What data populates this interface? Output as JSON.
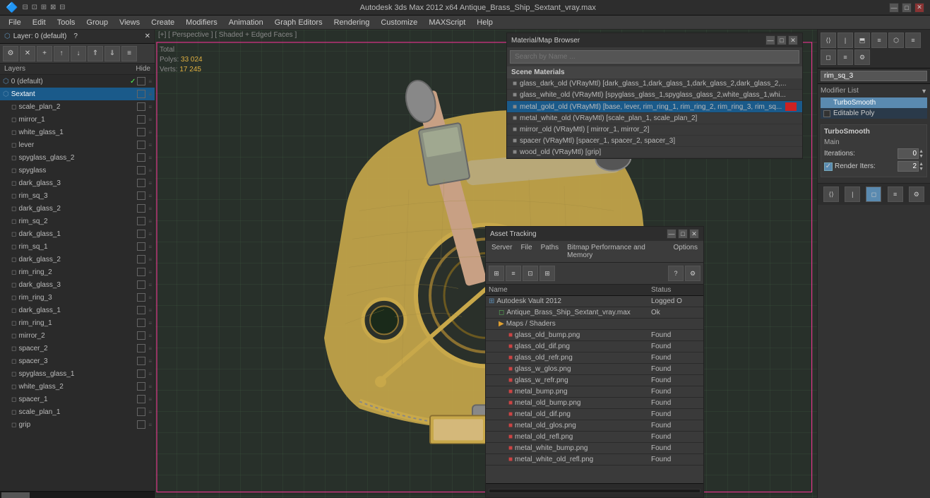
{
  "titleBar": {
    "left": "🔷",
    "center": "Autodesk 3ds Max 2012 x64    Antique_Brass_Ship_Sextant_vray.max",
    "buttons": [
      "—",
      "□",
      "✕"
    ]
  },
  "menuBar": {
    "items": [
      "File",
      "Edit",
      "Tools",
      "Group",
      "Views",
      "Create",
      "Modifiers",
      "Animation",
      "Graph Editors",
      "Rendering",
      "Customize",
      "MAXScript",
      "Help"
    ]
  },
  "viewport": {
    "label": "[+] [ Perspective ] [ Shaded + Edged Faces ]",
    "stats": {
      "label_total": "Total",
      "polys_label": "Polys:",
      "polys_value": "33 024",
      "verts_label": "Verts:",
      "verts_value": "17 245"
    }
  },
  "layerPanel": {
    "title": "Layer: 0 (default)",
    "help_icon": "?",
    "close_icon": "✕",
    "toolbar_buttons": [
      "⚙",
      "✕",
      "+",
      "↑",
      "↓",
      "⇑",
      "⇓",
      "≡"
    ],
    "header_layers": "Layers",
    "header_hide": "Hide",
    "layers": [
      {
        "name": "0 (default)",
        "indent": 0,
        "checked": true,
        "selected": false,
        "icon": "layer"
      },
      {
        "name": "Sextant",
        "indent": 0,
        "checked": false,
        "selected": true,
        "icon": "layer"
      },
      {
        "name": "scale_plan_2",
        "indent": 1,
        "checked": false,
        "selected": false,
        "icon": "object"
      },
      {
        "name": "mirror_1",
        "indent": 1,
        "checked": false,
        "selected": false,
        "icon": "object"
      },
      {
        "name": "white_glass_1",
        "indent": 1,
        "checked": false,
        "selected": false,
        "icon": "object"
      },
      {
        "name": "lever",
        "indent": 1,
        "checked": false,
        "selected": false,
        "icon": "object"
      },
      {
        "name": "spyglass_glass_2",
        "indent": 1,
        "checked": false,
        "selected": false,
        "icon": "object"
      },
      {
        "name": "spyglass",
        "indent": 1,
        "checked": false,
        "selected": false,
        "icon": "object"
      },
      {
        "name": "dark_glass_3",
        "indent": 1,
        "checked": false,
        "selected": false,
        "icon": "object"
      },
      {
        "name": "rim_sq_3",
        "indent": 1,
        "checked": false,
        "selected": false,
        "icon": "object"
      },
      {
        "name": "dark_glass_2",
        "indent": 1,
        "checked": false,
        "selected": false,
        "icon": "object"
      },
      {
        "name": "rim_sq_2",
        "indent": 1,
        "checked": false,
        "selected": false,
        "icon": "object"
      },
      {
        "name": "dark_glass_1",
        "indent": 1,
        "checked": false,
        "selected": false,
        "icon": "object"
      },
      {
        "name": "rim_sq_1",
        "indent": 1,
        "checked": false,
        "selected": false,
        "icon": "object"
      },
      {
        "name": "dark_glass_2",
        "indent": 1,
        "checked": false,
        "selected": false,
        "icon": "object"
      },
      {
        "name": "rim_ring_2",
        "indent": 1,
        "checked": false,
        "selected": false,
        "icon": "object"
      },
      {
        "name": "dark_glass_3",
        "indent": 1,
        "checked": false,
        "selected": false,
        "icon": "object"
      },
      {
        "name": "rim_ring_3",
        "indent": 1,
        "checked": false,
        "selected": false,
        "icon": "object"
      },
      {
        "name": "dark_glass_1",
        "indent": 1,
        "checked": false,
        "selected": false,
        "icon": "object"
      },
      {
        "name": "rim_ring_1",
        "indent": 1,
        "checked": false,
        "selected": false,
        "icon": "object"
      },
      {
        "name": "mirror_2",
        "indent": 1,
        "checked": false,
        "selected": false,
        "icon": "object"
      },
      {
        "name": "spacer_2",
        "indent": 1,
        "checked": false,
        "selected": false,
        "icon": "object"
      },
      {
        "name": "spacer_3",
        "indent": 1,
        "checked": false,
        "selected": false,
        "icon": "object"
      },
      {
        "name": "spyglass_glass_1",
        "indent": 1,
        "checked": false,
        "selected": false,
        "icon": "object"
      },
      {
        "name": "white_glass_2",
        "indent": 1,
        "checked": false,
        "selected": false,
        "icon": "object"
      },
      {
        "name": "spacer_1",
        "indent": 1,
        "checked": false,
        "selected": false,
        "icon": "object"
      },
      {
        "name": "scale_plan_1",
        "indent": 1,
        "checked": false,
        "selected": false,
        "icon": "object"
      },
      {
        "name": "grip",
        "indent": 1,
        "checked": false,
        "selected": false,
        "icon": "object"
      }
    ]
  },
  "modifierPanel": {
    "modifier_list_label": "Modifier List",
    "dropdown_arrow": "▼",
    "modifiers": [
      {
        "name": "TurboSmooth",
        "active": true
      },
      {
        "name": "Editable Poly",
        "active": false
      }
    ],
    "turbosmooth": {
      "title": "TurboSmooth",
      "main_label": "Main",
      "iterations_label": "Iterations:",
      "iterations_value": "0",
      "render_iters_label": "Render Iters:",
      "render_iters_value": "2",
      "render_iters_checkbox": true
    },
    "toolbar_icons": [
      "⟨⟩",
      "|",
      "⬒",
      "≡",
      "⬡",
      "≡",
      "◻",
      "≡",
      "⚙"
    ]
  },
  "materialBrowser": {
    "title": "Material/Map Browser",
    "search_placeholder": "Search by Name ...",
    "section_title": "Scene Materials",
    "materials": [
      {
        "name": "glass_dark_old (VRayMtl) [dark_glass_1,dark_glass_1,dark_glass_2,dark_glass_2,...",
        "selected": false
      },
      {
        "name": "glass_white_old (VRayMtl) [spyglass_glass_1,spyglass_glass_2,white_glass_1,whi...",
        "selected": false
      },
      {
        "name": "metal_gold_old (VRayMtl) [base, lever, rim_ring_1, rim_ring_2, rim_ring_3, rim_sq...",
        "selected": true
      },
      {
        "name": "metal_white_old (VRayMtl) [scale_plan_1, scale_plan_2]",
        "selected": false
      },
      {
        "name": "mirror_old (VRayMtl) [ mirror_1, mirror_2]",
        "selected": false
      },
      {
        "name": "spacer (VRayMtl) [spacer_1, spacer_2, spacer_3]",
        "selected": false
      },
      {
        "name": "wood_old (VRayMtl) [grip]",
        "selected": false
      }
    ],
    "close_btn": "✕",
    "min_btn": "—",
    "max_btn": "□"
  },
  "assetTracking": {
    "title": "Asset Tracking",
    "min_btn": "—",
    "max_btn": "□",
    "close_btn": "✕",
    "menu_items": [
      "Server",
      "File",
      "Paths",
      "Bitmap Performance and Memory",
      "Options"
    ],
    "toolbar_icons": [
      "⊞",
      "≡",
      "⊡",
      "⊞"
    ],
    "columns": {
      "name": "Name",
      "status": "Status"
    },
    "items": [
      {
        "type": "vault",
        "name": "Autodesk Vault 2012",
        "status": "Logged O",
        "indent": 0
      },
      {
        "type": "file",
        "name": "Antique_Brass_Ship_Sextant_vray.max",
        "status": "Ok",
        "indent": 1
      },
      {
        "type": "folder",
        "name": "Maps / Shaders",
        "status": "",
        "indent": 1
      },
      {
        "type": "map",
        "name": "glass_old_bump.png",
        "status": "Found",
        "indent": 2
      },
      {
        "type": "map",
        "name": "glass_old_dif.png",
        "status": "Found",
        "indent": 2
      },
      {
        "type": "map",
        "name": "glass_old_refr.png",
        "status": "Found",
        "indent": 2
      },
      {
        "type": "map",
        "name": "glass_w_glos.png",
        "status": "Found",
        "indent": 2
      },
      {
        "type": "map",
        "name": "glass_w_refr.png",
        "status": "Found",
        "indent": 2
      },
      {
        "type": "map",
        "name": "metal_bump.png",
        "status": "Found",
        "indent": 2
      },
      {
        "type": "map",
        "name": "metal_old_bump.png",
        "status": "Found",
        "indent": 2
      },
      {
        "type": "map",
        "name": "metal_old_dif.png",
        "status": "Found",
        "indent": 2
      },
      {
        "type": "map",
        "name": "metal_old_glos.png",
        "status": "Found",
        "indent": 2
      },
      {
        "type": "map",
        "name": "metal_old_refl.png",
        "status": "Found",
        "indent": 2
      },
      {
        "type": "map",
        "name": "metal_white_bump.png",
        "status": "Found",
        "indent": 2
      },
      {
        "type": "map",
        "name": "metal_white_old_refl.png",
        "status": "Found",
        "indent": 2
      }
    ]
  }
}
